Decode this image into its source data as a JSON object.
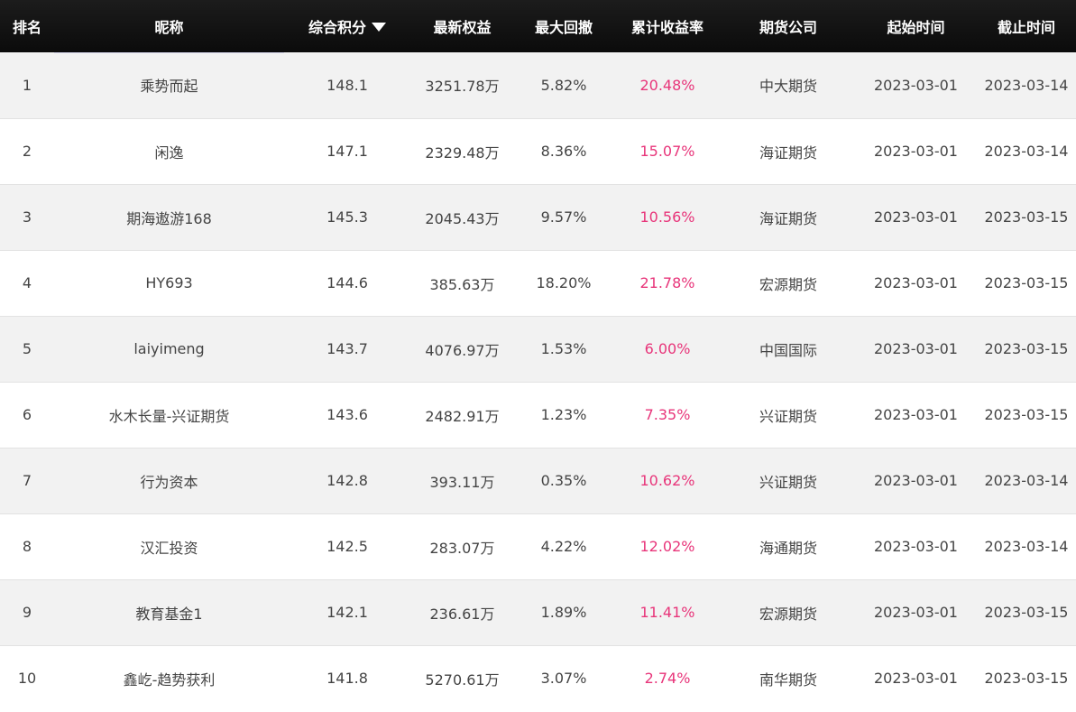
{
  "header": {
    "rank": "排名",
    "nickname": "昵称",
    "score": "综合积分",
    "equity": "最新权益",
    "drawdown": "最大回撤",
    "return": "累计收益率",
    "company": "期货公司",
    "start": "起始时间",
    "end": "截止时间"
  },
  "colors": {
    "header_bg": "#111111",
    "row_alt_bg": "#f2f2f2",
    "return_color": "#e8357a",
    "text": "#444444"
  },
  "sort_icon": "caret-down-icon",
  "rows": [
    {
      "rank": "1",
      "nickname": "乘势而起",
      "score": "148.1",
      "equity": "3251.78万",
      "drawdown": "5.82%",
      "return": "20.48%",
      "company": "中大期货",
      "start": "2023-03-01",
      "end": "2023-03-14"
    },
    {
      "rank": "2",
      "nickname": "闲逸",
      "score": "147.1",
      "equity": "2329.48万",
      "drawdown": "8.36%",
      "return": "15.07%",
      "company": "海证期货",
      "start": "2023-03-01",
      "end": "2023-03-14"
    },
    {
      "rank": "3",
      "nickname": "期海遨游168",
      "score": "145.3",
      "equity": "2045.43万",
      "drawdown": "9.57%",
      "return": "10.56%",
      "company": "海证期货",
      "start": "2023-03-01",
      "end": "2023-03-15"
    },
    {
      "rank": "4",
      "nickname": "HY693",
      "score": "144.6",
      "equity": "385.63万",
      "drawdown": "18.20%",
      "return": "21.78%",
      "company": "宏源期货",
      "start": "2023-03-01",
      "end": "2023-03-15"
    },
    {
      "rank": "5",
      "nickname": "laiyimeng",
      "score": "143.7",
      "equity": "4076.97万",
      "drawdown": "1.53%",
      "return": "6.00%",
      "company": "中国国际",
      "start": "2023-03-01",
      "end": "2023-03-15"
    },
    {
      "rank": "6",
      "nickname": "水木长量-兴证期货",
      "score": "143.6",
      "equity": "2482.91万",
      "drawdown": "1.23%",
      "return": "7.35%",
      "company": "兴证期货",
      "start": "2023-03-01",
      "end": "2023-03-15"
    },
    {
      "rank": "7",
      "nickname": "行为资本",
      "score": "142.8",
      "equity": "393.11万",
      "drawdown": "0.35%",
      "return": "10.62%",
      "company": "兴证期货",
      "start": "2023-03-01",
      "end": "2023-03-14"
    },
    {
      "rank": "8",
      "nickname": "汉汇投资",
      "score": "142.5",
      "equity": "283.07万",
      "drawdown": "4.22%",
      "return": "12.02%",
      "company": "海通期货",
      "start": "2023-03-01",
      "end": "2023-03-14"
    },
    {
      "rank": "9",
      "nickname": "教育基金1",
      "score": "142.1",
      "equity": "236.61万",
      "drawdown": "1.89%",
      "return": "11.41%",
      "company": "宏源期货",
      "start": "2023-03-01",
      "end": "2023-03-15"
    },
    {
      "rank": "10",
      "nickname": "鑫屹-趋势获利",
      "score": "141.8",
      "equity": "5270.61万",
      "drawdown": "3.07%",
      "return": "2.74%",
      "company": "南华期货",
      "start": "2023-03-01",
      "end": "2023-03-15"
    }
  ]
}
